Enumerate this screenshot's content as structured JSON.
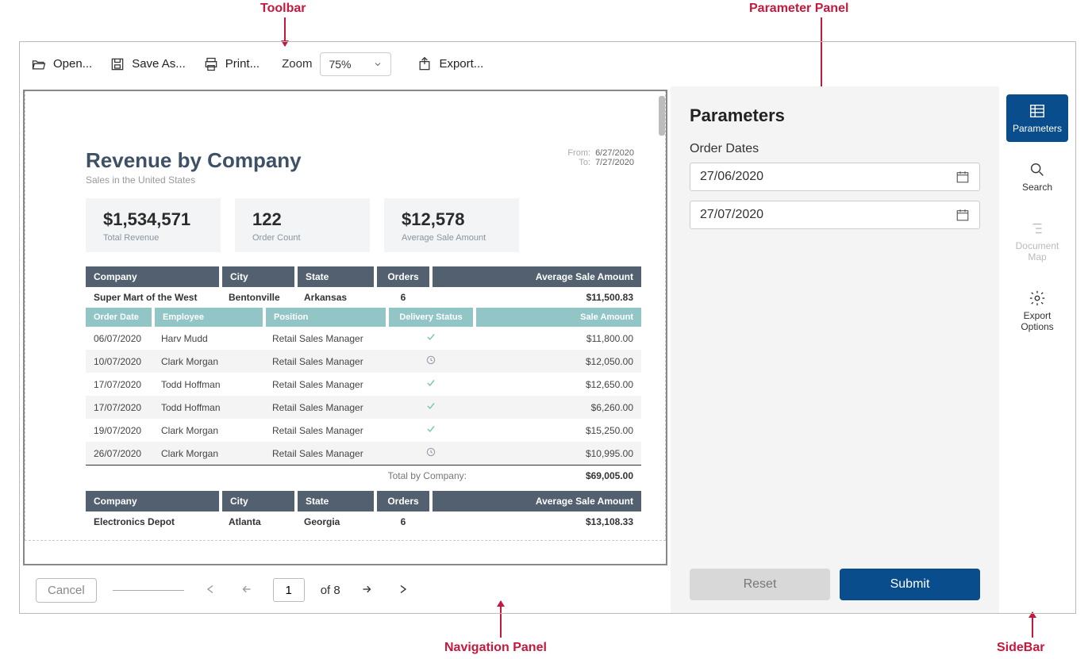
{
  "annotations": {
    "toolbar": "Toolbar",
    "param_panel": "Parameter Panel",
    "nav_panel": "Navigation Panel",
    "sidebar": "SideBar"
  },
  "toolbar": {
    "open": "Open...",
    "save_as": "Save As...",
    "print": "Print...",
    "zoom_label": "Zoom",
    "zoom_value": "75%",
    "export": "Export..."
  },
  "report": {
    "from_label": "From:",
    "from_value": "6/27/2020",
    "to_label": "To:",
    "to_value": "7/27/2020",
    "title": "Revenue by Company",
    "subtitle": "Sales in the United States",
    "kpis": [
      {
        "value": "$1,534,571",
        "label": "Total Revenue"
      },
      {
        "value": "122",
        "label": "Order Count"
      },
      {
        "value": "$12,578",
        "label": "Average Sale Amount"
      }
    ],
    "group_headers": [
      "Company",
      "City",
      "State",
      "Orders",
      "Average Sale Amount"
    ],
    "detail_headers": [
      "Order Date",
      "Employee",
      "Position",
      "Delivery Status",
      "Sale Amount"
    ],
    "companies": [
      {
        "name": "Super Mart of the West",
        "city": "Bentonville",
        "state": "Arkansas",
        "orders": "6",
        "avg": "$11,500.83",
        "rows": [
          {
            "date": "06/07/2020",
            "employee": "Harv Mudd",
            "position": "Retail Sales Manager",
            "status": "check",
            "amount": "$11,800.00"
          },
          {
            "date": "10/07/2020",
            "employee": "Clark Morgan",
            "position": "Retail Sales Manager",
            "status": "clock",
            "amount": "$12,050.00"
          },
          {
            "date": "17/07/2020",
            "employee": "Todd Hoffman",
            "position": "Retail Sales Manager",
            "status": "check",
            "amount": "$12,650.00"
          },
          {
            "date": "17/07/2020",
            "employee": "Todd Hoffman",
            "position": "Retail Sales Manager",
            "status": "check",
            "amount": "$6,260.00"
          },
          {
            "date": "19/07/2020",
            "employee": "Clark Morgan",
            "position": "Retail Sales Manager",
            "status": "check",
            "amount": "$15,250.00"
          },
          {
            "date": "26/07/2020",
            "employee": "Clark Morgan",
            "position": "Retail Sales Manager",
            "status": "clock",
            "amount": "$10,995.00"
          }
        ],
        "total_label": "Total by Company:",
        "total": "$69,005.00"
      },
      {
        "name": "Electronics Depot",
        "city": "Atlanta",
        "state": "Georgia",
        "orders": "6",
        "avg": "$13,108.33"
      }
    ]
  },
  "nav": {
    "cancel": "Cancel",
    "page": "1",
    "of": "of 8"
  },
  "parameters": {
    "title": "Parameters",
    "label": "Order Dates",
    "date_from": "27/06/2020",
    "date_to": "27/07/2020",
    "reset": "Reset",
    "submit": "Submit"
  },
  "sidebar": {
    "parameters": "Parameters",
    "search": "Search",
    "docmap": "Document Map",
    "export": "Export Options"
  }
}
